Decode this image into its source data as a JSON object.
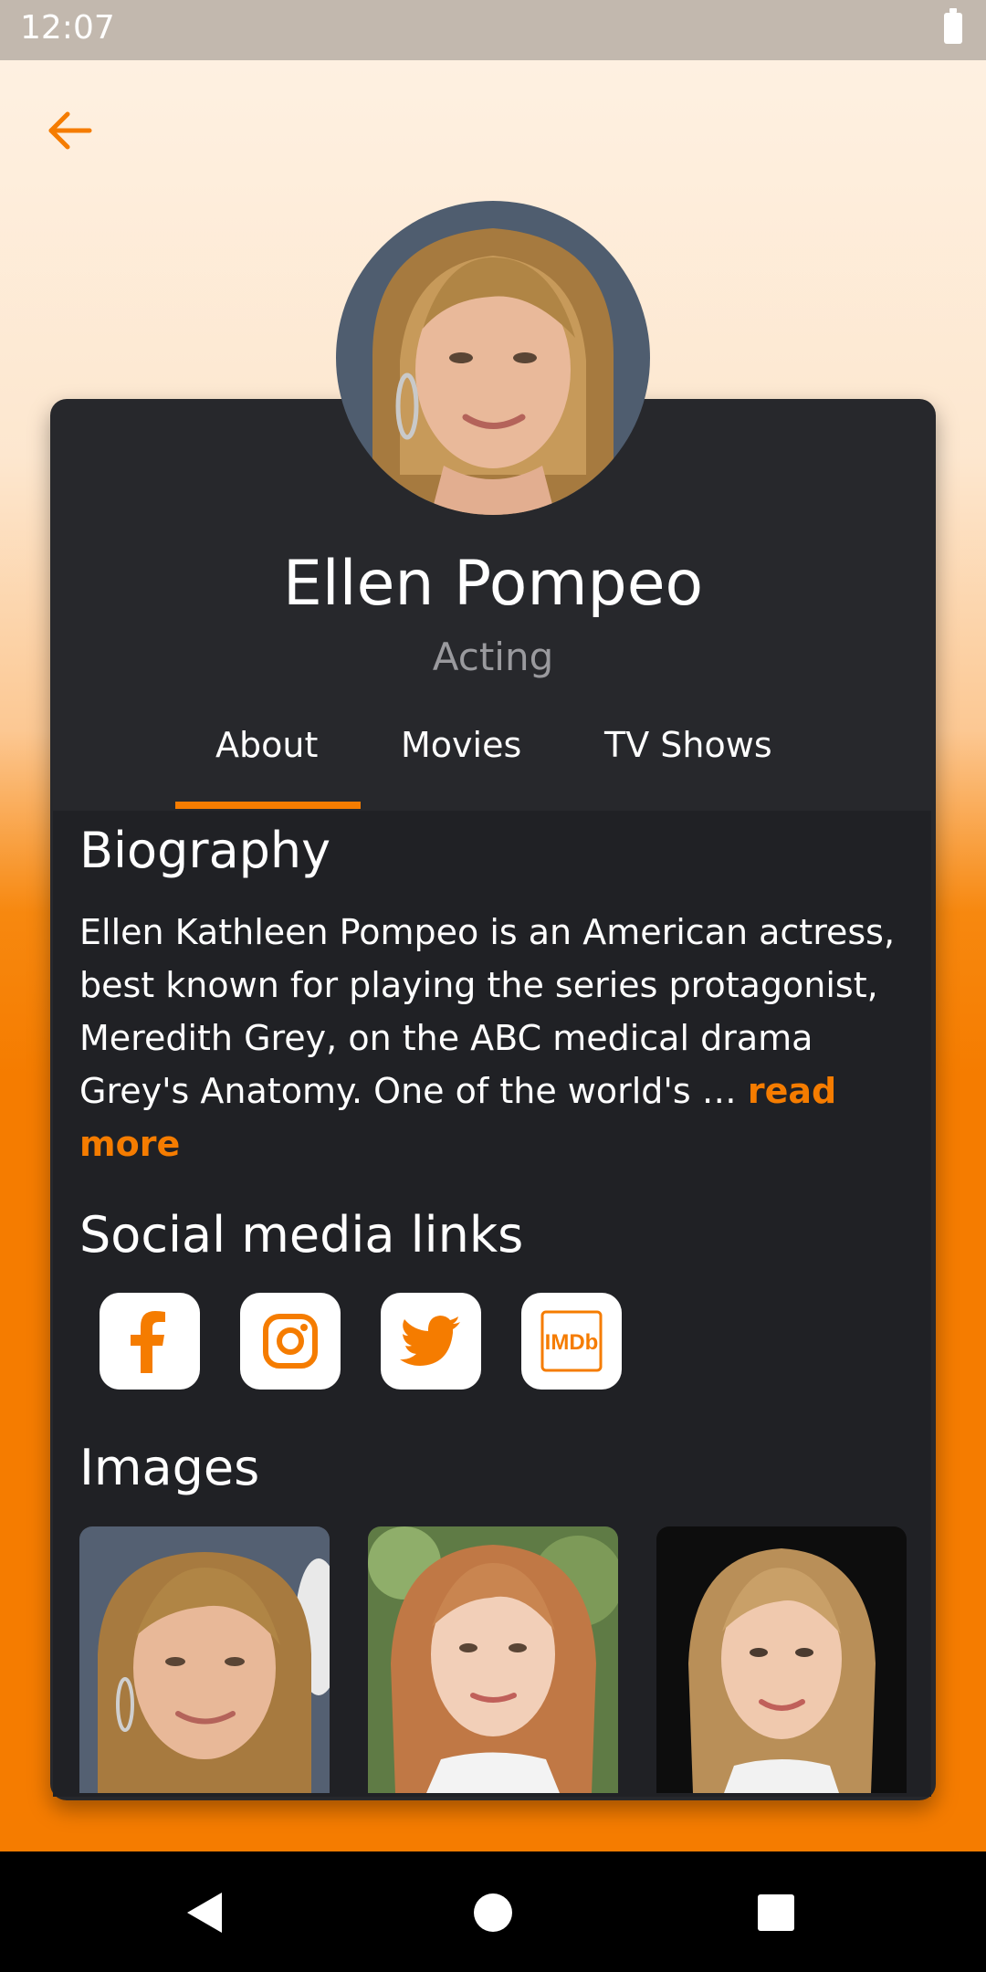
{
  "status": {
    "time": "12:07"
  },
  "profile": {
    "name": "Ellen Pompeo",
    "department": "Acting"
  },
  "tabs": [
    {
      "label": "About",
      "active": true
    },
    {
      "label": "Movies",
      "active": false
    },
    {
      "label": "TV Shows",
      "active": false
    }
  ],
  "about": {
    "biography_title": "Biography",
    "biography_text": "Ellen Kathleen Pompeo is an American actress, best known for playing the series protagonist, Meredith Grey, on the ABC medical drama Grey's Anatomy. One of the world's … ",
    "read_more": "read more",
    "social_title": "Social media links",
    "social_links": [
      {
        "icon": "facebook-icon"
      },
      {
        "icon": "instagram-icon"
      },
      {
        "icon": "twitter-icon"
      },
      {
        "icon": "imdb-icon",
        "text": "IMDb"
      }
    ],
    "images_title": "Images"
  },
  "colors": {
    "accent": "#f57c00",
    "card": "#27282c",
    "content": "#202125"
  }
}
